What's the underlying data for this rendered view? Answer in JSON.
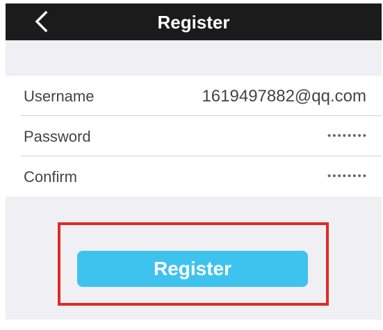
{
  "navbar": {
    "title": "Register",
    "back_icon": "chevron-left-icon"
  },
  "form": {
    "fields": [
      {
        "label": "Username",
        "value": "1619497882@qq.com"
      },
      {
        "label": "Password",
        "value": "••••••••"
      },
      {
        "label": "Confirm",
        "value": "••••••••"
      }
    ]
  },
  "actions": {
    "register_label": "Register"
  },
  "colors": {
    "navbar_background": "#1b1b1b",
    "page_background": "#efeff4",
    "register_button": "#3ec3ef",
    "highlight_border": "#e02a22"
  }
}
